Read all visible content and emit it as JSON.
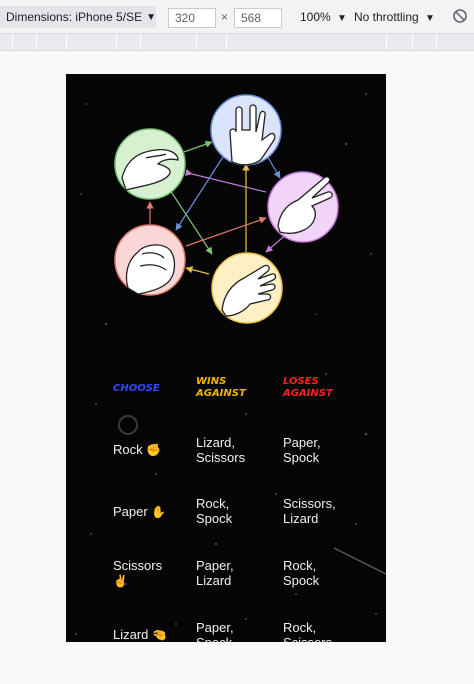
{
  "devtools": {
    "dimensions_label": "Dimensions: iPhone 5/SE",
    "width": "320",
    "times": "×",
    "height": "568",
    "zoom": "100%",
    "throttling": "No throttling"
  },
  "table": {
    "headers": {
      "choose": "CHOOSE",
      "wins": "WINS AGAINST",
      "loses": "LOSES AGAINST"
    },
    "rows": [
      {
        "choice": "Rock",
        "icon": "fist-icon",
        "wins": "Lizard,\nScissors",
        "loses": "Paper,\nSpock"
      },
      {
        "choice": "Paper",
        "icon": "hand-paper-icon",
        "wins": "Rock,\nSpock",
        "loses": "Scissors,\nLizard"
      },
      {
        "choice": "Scissors",
        "icon": "hand-scissors-icon",
        "wins": "Paper,\nLizard",
        "loses": "Rock,\nSpock"
      },
      {
        "choice": "Lizard",
        "icon": "hand-lizard-icon",
        "wins": "Paper,\nSpock",
        "loses": "Rock,\nScissors"
      }
    ]
  },
  "colors": {
    "header_choose": "#2c4bff",
    "header_wins": "#f6b400",
    "header_loses": "#ff2020"
  }
}
